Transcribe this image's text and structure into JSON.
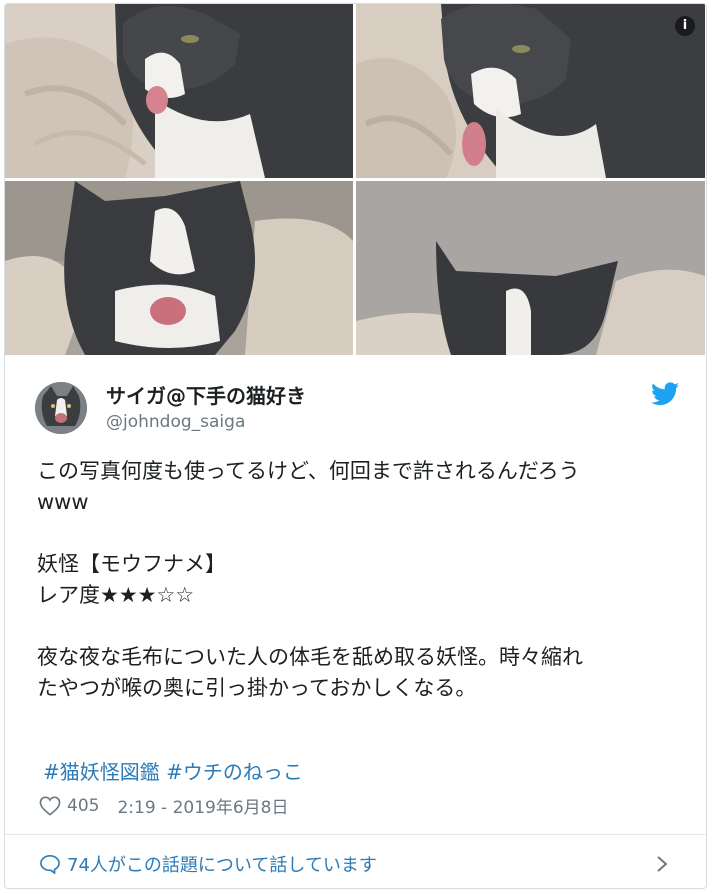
{
  "photos": [
    {
      "icon": "cat-photo-tongue-out"
    },
    {
      "icon": "cat-photo-licking"
    },
    {
      "icon": "cat-photo-mouth-open"
    },
    {
      "icon": "cat-photo-peeking"
    }
  ],
  "info_icon": "i",
  "author": {
    "display_name": "サイガ@下手の猫好き",
    "handle": "@johndog_saiga",
    "avatar_icon": "cat-avatar"
  },
  "brand_icon": "twitter-bird-icon",
  "colors": {
    "link": "#2b7bb9",
    "brand": "#1da1f2",
    "muted": "#697882",
    "text": "#1c2022"
  },
  "tweet": {
    "lines": [
      "この写真何度も使ってるけど、何回まで許されるんだろう",
      "www",
      "",
      "妖怪【モウフナメ】",
      "レア度★★★☆☆",
      "",
      "夜な夜な毛布についた人の体毛を舐め取る妖怪。時々縮れ",
      "たやつが喉の奥に引っ掛かっておかしくなる。"
    ],
    "hashtags": [
      "#猫妖怪図鑑",
      "#ウチのねっこ"
    ]
  },
  "meta": {
    "likes": "405",
    "timestamp": "2:19 - 2019年6月8日"
  },
  "footer": {
    "conversation_label": "74人がこの話題について話しています"
  }
}
